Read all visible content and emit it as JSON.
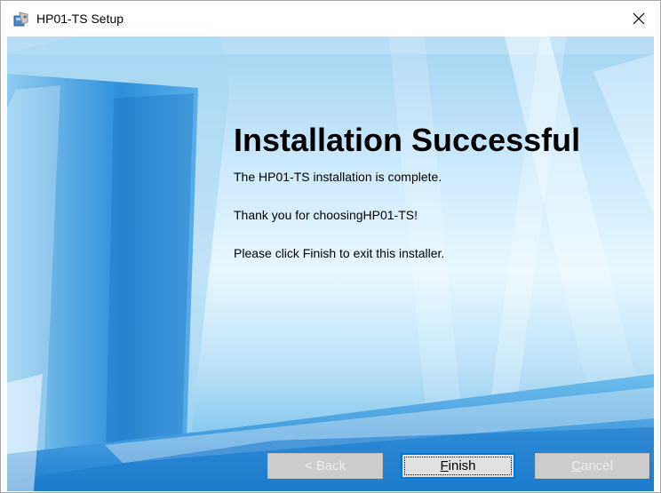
{
  "window": {
    "title": "HP01-TS Setup",
    "close_glyph": "×"
  },
  "main": {
    "heading": "Installation Successful",
    "messages": [
      "The HP01-TS installation is complete.",
      "Thank you for choosingHP01-TS!",
      "Please click Finish to exit this installer."
    ]
  },
  "buttons": {
    "back_label": "< Back",
    "finish_label": "Finish",
    "cancel_label": "Cancel"
  },
  "icons": {
    "app": "installer-icon",
    "close": "close-icon"
  },
  "colors": {
    "focus_border": "#0078d7",
    "disabled_button": "#cccccc",
    "background_blue": "#5ab3ea"
  }
}
